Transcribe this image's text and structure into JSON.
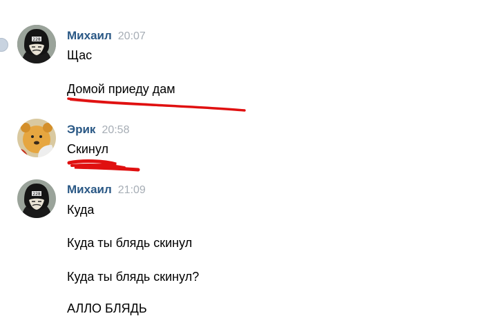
{
  "top_fragment": "... ",
  "messages": [
    {
      "author": "Михаил",
      "time": "20:07",
      "lines": [
        "Щас",
        "Домой приеду дам"
      ]
    },
    {
      "author": "Эрик",
      "time": "20:58",
      "lines": [
        "Скинул"
      ]
    },
    {
      "author": "Михаил",
      "time": "21:09",
      "lines": [
        "Куда",
        "Куда ты блядь скинул",
        "Куда ты блядь скинул?",
        "АЛЛО БЛЯДЬ"
      ]
    }
  ],
  "colors": {
    "author_name": "#2a5885",
    "timestamp": "#a6adb5",
    "annotation_red": "#e01010"
  }
}
